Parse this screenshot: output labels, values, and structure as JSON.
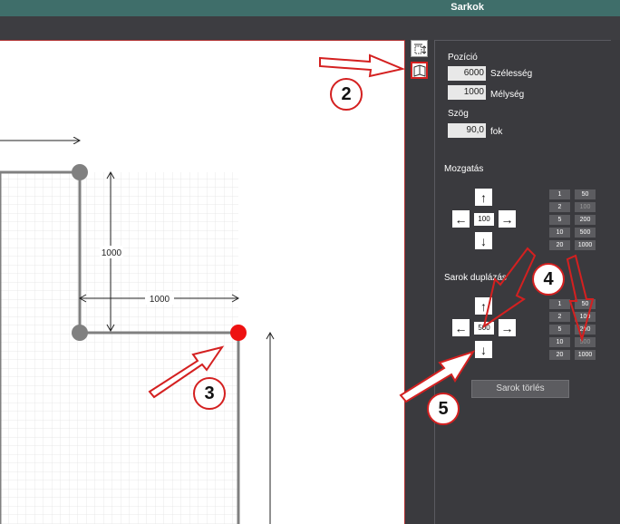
{
  "window": {
    "title": "Sarkok"
  },
  "canvas": {
    "dimensions": [
      "1000",
      "1000"
    ]
  },
  "panel": {
    "position": {
      "header": "Pozíció",
      "width_value": "6000",
      "width_label": "Szélesség",
      "depth_value": "1000",
      "depth_label": "Mélység"
    },
    "angle": {
      "header": "Szög",
      "value": "90,0",
      "unit": "fok"
    },
    "move": {
      "header": "Mozgatás",
      "center_value": "100",
      "steps_left": [
        "1",
        "2",
        "5",
        "10",
        "20"
      ],
      "steps_right": [
        "50",
        "100",
        "200",
        "500",
        "1000"
      ]
    },
    "duplicate": {
      "header": "Sarok duplázás",
      "center_value": "500",
      "steps_left": [
        "1",
        "2",
        "5",
        "10",
        "20"
      ],
      "steps_right": [
        "50",
        "100",
        "200",
        "500",
        "1000"
      ]
    },
    "delete_button": "Sarok törlés"
  },
  "callouts": [
    "2",
    "3",
    "4",
    "5"
  ],
  "icons": {
    "up": "↑",
    "down": "↓",
    "left": "←",
    "right": "→"
  },
  "colors": {
    "titlebar": "#3f6e6a",
    "panel_bg": "#3a3a3e",
    "accent_red": "#d42020",
    "selected_point": "#ee1111",
    "corner_point": "#808080"
  }
}
